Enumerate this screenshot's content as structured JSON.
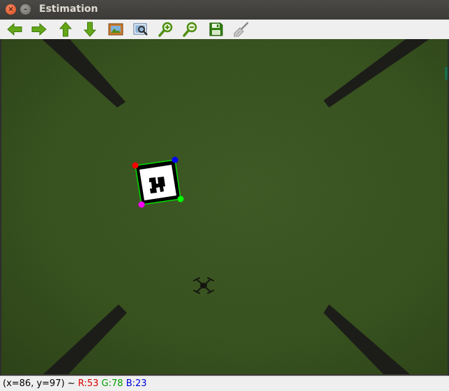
{
  "window": {
    "title": "Estimation",
    "close_glyph": "×",
    "minimize_glyph": "–"
  },
  "toolbar": {
    "buttons": [
      {
        "name": "pan-left-button",
        "icon": "arrow-left-icon"
      },
      {
        "name": "pan-right-button",
        "icon": "arrow-right-icon"
      },
      {
        "name": "pan-up-button",
        "icon": "arrow-up-icon"
      },
      {
        "name": "pan-down-button",
        "icon": "arrow-down-icon"
      },
      {
        "name": "zoom-original-button",
        "icon": "picture-icon"
      },
      {
        "name": "zoom-fit-button",
        "icon": "zoom-area-icon"
      },
      {
        "name": "zoom-in-button",
        "icon": "zoom-in-icon"
      },
      {
        "name": "zoom-out-button",
        "icon": "zoom-out-icon"
      },
      {
        "name": "save-button",
        "icon": "floppy-disk-icon"
      },
      {
        "name": "properties-button",
        "icon": "broom-icon"
      }
    ]
  },
  "status": {
    "coords": "(x=86, y=97) ~",
    "r_label": "R:53",
    "g_label": "G:78",
    "b_label": "B:23",
    "r_color": "#dd0000",
    "g_color": "#00a000",
    "b_color": "#0000dd"
  },
  "image": {
    "ground_color": "#3f5a22",
    "marker_corner_colors": [
      "#ff0000",
      "#0000ff",
      "#00ff00",
      "#ff00ff"
    ],
    "marker_outline_color": "#00dd00"
  }
}
